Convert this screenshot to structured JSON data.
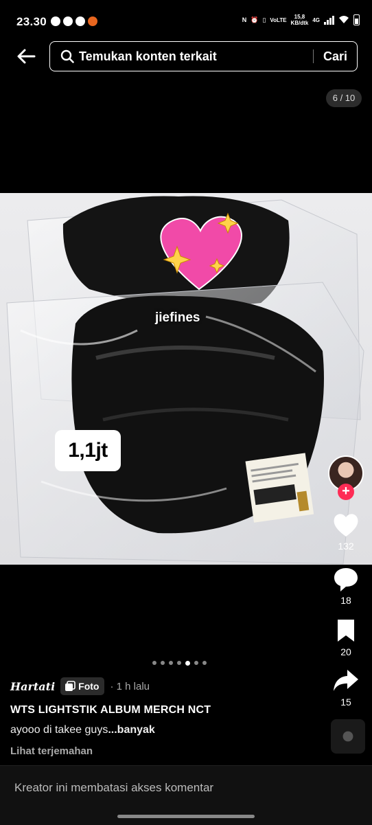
{
  "status_bar": {
    "time": "23.30",
    "volte_label": "VoLTE",
    "speed_value": "15,8",
    "speed_unit": "KB/dtk",
    "network": "4G"
  },
  "search": {
    "query": "Temukan konten terkait",
    "button_label": "Cari"
  },
  "page_counter": "6 / 10",
  "photo": {
    "watermark": "jiefines",
    "price_overlay": "1,1jt"
  },
  "actions": {
    "likes": "132",
    "comments": "18",
    "bookmarks": "20",
    "shares": "15"
  },
  "carousel": {
    "dot_count": 7,
    "active_index": 4
  },
  "post": {
    "author": "Hartati",
    "type_badge": "Foto",
    "time": "· 1 h lalu",
    "title": "WTS LIGHTSTIK ALBUM MERCH NCT",
    "caption": "ayooo di takee guys",
    "caption_more": "...banyak",
    "translate": "Lihat terjemahan"
  },
  "comment_bar": {
    "text": "Kreator ini membatasi akses komentar"
  },
  "colors": {
    "background": "#000000",
    "follow_accent": "#fe2c55",
    "badge_bg": "#2b2b2b"
  }
}
